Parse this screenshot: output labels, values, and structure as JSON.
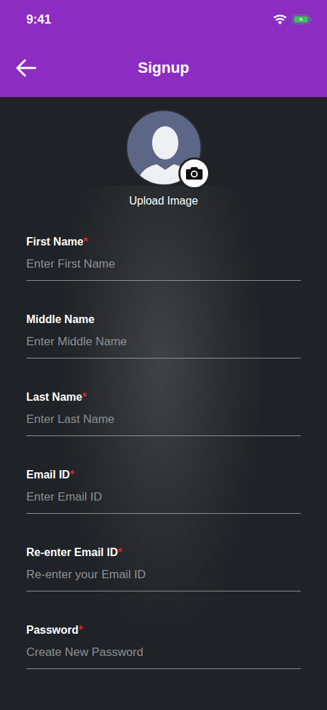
{
  "status_bar": {
    "time": "9:41",
    "battery": {
      "charging": true
    }
  },
  "app_bar": {
    "title": "Signup"
  },
  "avatar": {
    "upload_label": "Upload Image"
  },
  "required_mark": "*",
  "fields": [
    {
      "label": "First Name",
      "placeholder": "Enter First Name",
      "required": true
    },
    {
      "label": "Middle Name",
      "placeholder": "Enter Middle Name",
      "required": false
    },
    {
      "label": "Last Name",
      "placeholder": "Enter Last Name",
      "required": true
    },
    {
      "label": "Email ID",
      "placeholder": "Enter Email ID",
      "required": true
    },
    {
      "label": "Re-enter Email ID",
      "placeholder": "Re-enter your Email ID",
      "required": true
    },
    {
      "label": "Password",
      "placeholder": "Create New Password",
      "required": true
    }
  ]
}
